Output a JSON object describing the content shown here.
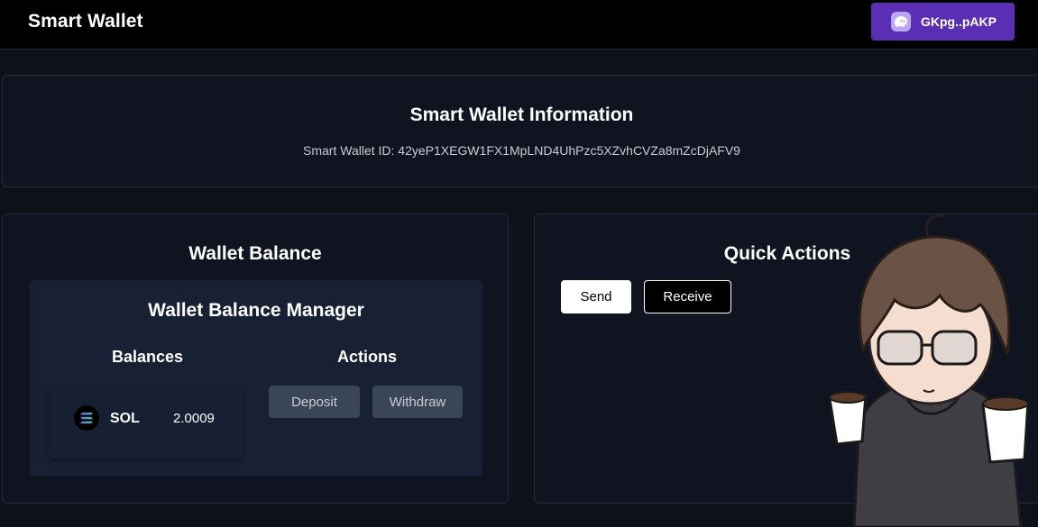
{
  "header": {
    "title": "Smart Wallet",
    "wallet_button": {
      "address": "GKpg..pAKP",
      "icon": "phantom-ghost-icon",
      "color": "#5b2fb3"
    }
  },
  "info": {
    "title": "Smart Wallet Information",
    "id_text": "Smart Wallet ID: 42yeP1XEGW1FX1MpLND4UhPzc5XZvhCVZa8mZcDjAFV9"
  },
  "balance_card": {
    "title": "Wallet Balance",
    "manager": {
      "title": "Wallet Balance Manager",
      "balances_heading": "Balances",
      "actions_heading": "Actions",
      "tokens": [
        {
          "icon": "solana-icon",
          "symbol": "SOL",
          "amount": "2.0009"
        }
      ],
      "deposit_label": "Deposit",
      "withdraw_label": "Withdraw"
    }
  },
  "quick_actions": {
    "title": "Quick Actions",
    "send_label": "Send",
    "receive_label": "Receive"
  },
  "colors": {
    "background": "#0d111a",
    "card": "#0f1420",
    "accent": "#5b2fb3"
  }
}
